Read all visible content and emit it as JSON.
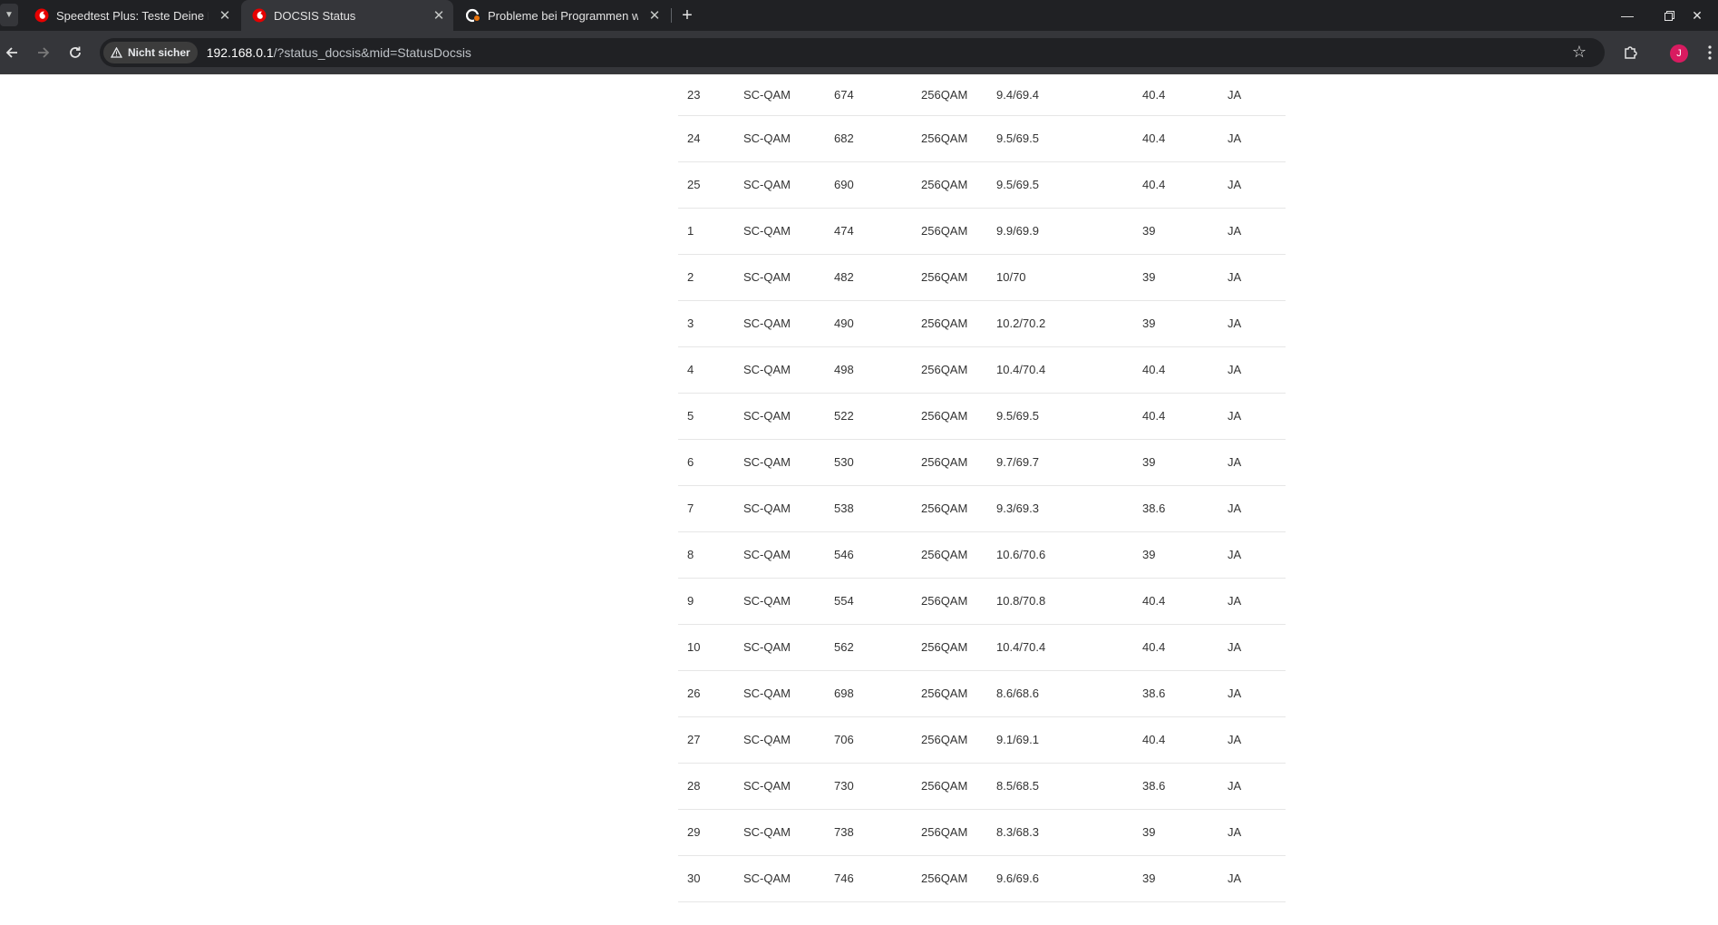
{
  "browser": {
    "tabs": [
      {
        "title": "Speedtest Plus: Teste Deine Inte",
        "favicon": "vodafone-icon",
        "active": false
      },
      {
        "title": "DOCSIS Status",
        "favicon": "vodafone-icon",
        "active": true
      },
      {
        "title": "Probleme bei Programmen wie",
        "favicon": "community-icon",
        "active": false
      }
    ],
    "security_label": "Nicht sicher",
    "url_host": "192.168.0.1",
    "url_path": "/?status_docsis&mid=StatusDocsis",
    "avatar_initial": "J",
    "accent_color": "#e60000"
  },
  "table": {
    "rows": [
      {
        "id": "23",
        "type": "SC-QAM",
        "freq": "674",
        "mod": "256QAM",
        "power": "9.4/69.4",
        "snr": "40.4",
        "lock": "JA"
      },
      {
        "id": "24",
        "type": "SC-QAM",
        "freq": "682",
        "mod": "256QAM",
        "power": "9.5/69.5",
        "snr": "40.4",
        "lock": "JA"
      },
      {
        "id": "25",
        "type": "SC-QAM",
        "freq": "690",
        "mod": "256QAM",
        "power": "9.5/69.5",
        "snr": "40.4",
        "lock": "JA"
      },
      {
        "id": "1",
        "type": "SC-QAM",
        "freq": "474",
        "mod": "256QAM",
        "power": "9.9/69.9",
        "snr": "39",
        "lock": "JA"
      },
      {
        "id": "2",
        "type": "SC-QAM",
        "freq": "482",
        "mod": "256QAM",
        "power": "10/70",
        "snr": "39",
        "lock": "JA"
      },
      {
        "id": "3",
        "type": "SC-QAM",
        "freq": "490",
        "mod": "256QAM",
        "power": "10.2/70.2",
        "snr": "39",
        "lock": "JA"
      },
      {
        "id": "4",
        "type": "SC-QAM",
        "freq": "498",
        "mod": "256QAM",
        "power": "10.4/70.4",
        "snr": "40.4",
        "lock": "JA"
      },
      {
        "id": "5",
        "type": "SC-QAM",
        "freq": "522",
        "mod": "256QAM",
        "power": "9.5/69.5",
        "snr": "40.4",
        "lock": "JA"
      },
      {
        "id": "6",
        "type": "SC-QAM",
        "freq": "530",
        "mod": "256QAM",
        "power": "9.7/69.7",
        "snr": "39",
        "lock": "JA"
      },
      {
        "id": "7",
        "type": "SC-QAM",
        "freq": "538",
        "mod": "256QAM",
        "power": "9.3/69.3",
        "snr": "38.6",
        "lock": "JA"
      },
      {
        "id": "8",
        "type": "SC-QAM",
        "freq": "546",
        "mod": "256QAM",
        "power": "10.6/70.6",
        "snr": "39",
        "lock": "JA"
      },
      {
        "id": "9",
        "type": "SC-QAM",
        "freq": "554",
        "mod": "256QAM",
        "power": "10.8/70.8",
        "snr": "40.4",
        "lock": "JA"
      },
      {
        "id": "10",
        "type": "SC-QAM",
        "freq": "562",
        "mod": "256QAM",
        "power": "10.4/70.4",
        "snr": "40.4",
        "lock": "JA"
      },
      {
        "id": "26",
        "type": "SC-QAM",
        "freq": "698",
        "mod": "256QAM",
        "power": "8.6/68.6",
        "snr": "38.6",
        "lock": "JA"
      },
      {
        "id": "27",
        "type": "SC-QAM",
        "freq": "706",
        "mod": "256QAM",
        "power": "9.1/69.1",
        "snr": "40.4",
        "lock": "JA"
      },
      {
        "id": "28",
        "type": "SC-QAM",
        "freq": "730",
        "mod": "256QAM",
        "power": "8.5/68.5",
        "snr": "38.6",
        "lock": "JA"
      },
      {
        "id": "29",
        "type": "SC-QAM",
        "freq": "738",
        "mod": "256QAM",
        "power": "8.3/68.3",
        "snr": "39",
        "lock": "JA"
      },
      {
        "id": "30",
        "type": "SC-QAM",
        "freq": "746",
        "mod": "256QAM",
        "power": "9.6/69.6",
        "snr": "39",
        "lock": "JA"
      }
    ]
  }
}
